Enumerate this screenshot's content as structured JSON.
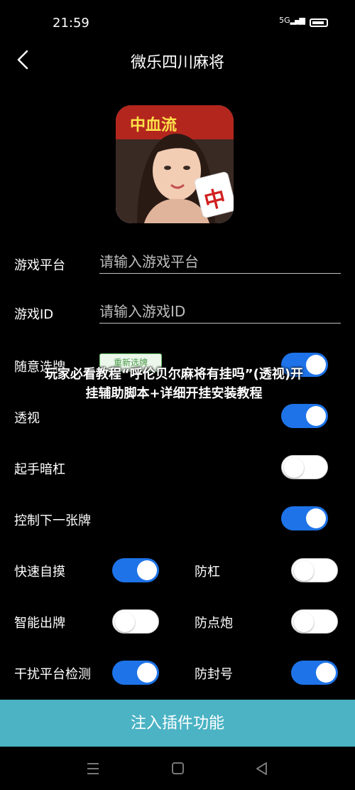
{
  "status": {
    "time": "21:59",
    "signal": "5G"
  },
  "header": {
    "title": "微乐四川麻将"
  },
  "avatar": {
    "banner_text": "中血流",
    "tile_text": "中"
  },
  "form": {
    "platform_label": "游戏平台",
    "platform_placeholder": "请输入游戏平台",
    "id_label": "游戏ID",
    "id_placeholder": "请输入游戏ID"
  },
  "options": {
    "random_label": "随意选牌",
    "reselect_label": "重新选牌",
    "xray_label": "透视",
    "opening_label": "起手暗杠",
    "control_label": "控制下一张牌",
    "quick_label": "快速自摸",
    "anti_kong_label": "防杠",
    "smart_label": "智能出牌",
    "anti_cannon_label": "防点炮",
    "interfere_label": "干扰平台检测",
    "anti_ban_label": "防封号"
  },
  "overlay": {
    "text": "玩家必看教程“呼伦贝尔麻将有挂吗”(透视)开挂辅助脚本+详细开挂安装教程"
  },
  "footer": {
    "inject_label": "注入插件功能"
  },
  "toggles": {
    "random": true,
    "xray": true,
    "opening": false,
    "control": true,
    "quick": true,
    "anti_kong": false,
    "smart": false,
    "anti_cannon": false,
    "interfere": true,
    "anti_ban": true
  },
  "colors": {
    "accent": "#1e73e8",
    "inject_bg": "#4bb3c4",
    "background": "#000000"
  },
  "icons": [
    "back-arrow-icon",
    "signal-icon",
    "battery-icon",
    "nav-menu-icon",
    "nav-home-icon",
    "nav-back-icon"
  ]
}
